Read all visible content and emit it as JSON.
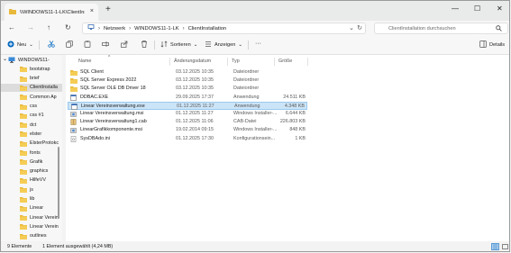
{
  "tab": {
    "title": "\\\\WINDOWS11-1-LK\\ClientInst",
    "close": "×",
    "new": "+"
  },
  "window": {
    "minimize": "—",
    "maximize": "☐",
    "close": "✕"
  },
  "nav": {
    "back": "←",
    "forward": "→",
    "up": "↑",
    "refresh": "↻",
    "more": "›"
  },
  "address": {
    "crumbs": [
      "Netzwerk",
      "WINDOWS11-1-LK",
      "ClientInstallation"
    ],
    "sep": "›",
    "dropdown": "⌄"
  },
  "search": {
    "placeholder": "ClientInstallation durchsuchen"
  },
  "toolbar": {
    "new_label": "Neu",
    "sort_label": "Sortieren",
    "view_label": "Anzeigen",
    "more": "···",
    "details_label": "Details",
    "chevron": "⌄"
  },
  "sidebar": {
    "items": [
      {
        "label": "WINDOWS11-",
        "expander": "⌄",
        "icon": "computer-icon"
      },
      {
        "label": "bootstrap",
        "icon": "folder-icon"
      },
      {
        "label": "brief",
        "icon": "folder-icon"
      },
      {
        "label": "ClientInstalla",
        "icon": "folder-icon"
      },
      {
        "label": "Common Ap",
        "icon": "folder-icon"
      },
      {
        "label": "css",
        "icon": "folder-icon"
      },
      {
        "label": "css #1",
        "icon": "folder-icon"
      },
      {
        "label": "dct",
        "icon": "folder-icon"
      },
      {
        "label": "elster",
        "icon": "folder-icon"
      },
      {
        "label": "ElsterProtokc",
        "icon": "folder-icon"
      },
      {
        "label": "fonts",
        "icon": "folder-icon"
      },
      {
        "label": "Grafik",
        "icon": "folder-icon"
      },
      {
        "label": "graphics",
        "icon": "folder-icon"
      },
      {
        "label": "HilfeVV",
        "icon": "folder-icon"
      },
      {
        "label": "js",
        "icon": "folder-icon"
      },
      {
        "label": "lib",
        "icon": "folder-icon"
      },
      {
        "label": "Linear",
        "icon": "folder-icon"
      },
      {
        "label": "Linear Verein",
        "icon": "folder-icon"
      },
      {
        "label": "Linear Verein",
        "icon": "folder-icon"
      },
      {
        "label": "outlines",
        "icon": "folder-icon"
      }
    ]
  },
  "table": {
    "columns": [
      "Name",
      "Änderungsdatum",
      "Typ",
      "Größe"
    ],
    "sort_indicator": "^",
    "rows": [
      {
        "name": "SQL Client",
        "date": "03.12.2025 10:35",
        "type": "Dateiordner",
        "size": "",
        "icon": "folder-icon"
      },
      {
        "name": "SQL Server Express 2022",
        "date": "03.12.2025 10:35",
        "type": "Dateiordner",
        "size": "",
        "icon": "folder-icon"
      },
      {
        "name": "SQL Server OLE DB Driver 18",
        "date": "03.12.2025 10:35",
        "type": "Dateiordner",
        "size": "",
        "icon": "folder-icon"
      },
      {
        "name": "DDBAC.EXE",
        "date": "29.09.2025 17:37",
        "type": "Anwendung",
        "size": "24.511 KB",
        "icon": "exe-icon"
      },
      {
        "name": "Linear Vereinsverwaltung.exe",
        "date": "01.12.2025 11:27",
        "type": "Anwendung",
        "size": "4.348 KB",
        "icon": "exe-icon"
      },
      {
        "name": "Linear Vereinsverwaltung.msi",
        "date": "01.12.2025 11:27",
        "type": "Windows Installer-...",
        "size": "6.644 KB",
        "icon": "msi-icon"
      },
      {
        "name": "Linear Vereinsverwaltung1.cab",
        "date": "01.12.2025 11:06",
        "type": "CAB-Datei",
        "size": "226.803 KB",
        "icon": "cab-icon"
      },
      {
        "name": "LinearGrafikkomponente.msi",
        "date": "19.02.2014 09:15",
        "type": "Windows Installer-...",
        "size": "848 KB",
        "icon": "msi-icon"
      },
      {
        "name": "SysDBAdo.ini",
        "date": "01.12.2025 17:30",
        "type": "Konfigurationsein...",
        "size": "1 KB",
        "icon": "ini-icon"
      }
    ]
  },
  "status": {
    "count": "9 Elemente",
    "selection": "1 Element ausgewählt (4,24 MB)"
  },
  "colors": {
    "folder": "#e8b83a",
    "selection": "#cce4f7",
    "accent": "#0067c0"
  }
}
